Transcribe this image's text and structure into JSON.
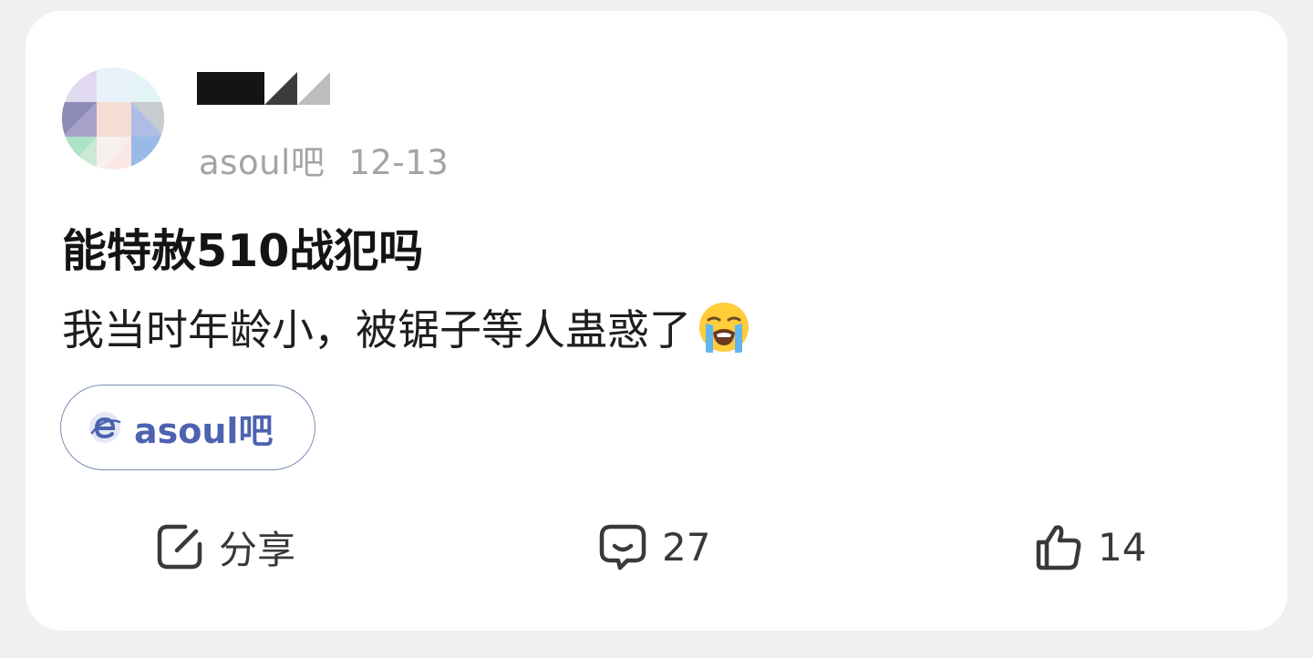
{
  "post": {
    "author_name": "",
    "forum": "asoul吧",
    "date": "12-13",
    "title": "能特赦510战犯吗",
    "body": "我当时年龄小，被锯子等人蛊惑了",
    "body_emoji": "loudly-crying-face-icon"
  },
  "forum_tag": {
    "label": "asoul吧",
    "icon": "tieba-logo-icon"
  },
  "actions": {
    "share_label": "分享",
    "share_icon": "share-icon",
    "comment_count": "27",
    "comment_icon": "comment-bubble-icon",
    "like_count": "14",
    "like_icon": "thumbs-up-icon"
  },
  "colors": {
    "background": "#f0f0f3",
    "card": "#ffffff",
    "accent": "#4d63b0",
    "muted": "#a3a3a8"
  }
}
